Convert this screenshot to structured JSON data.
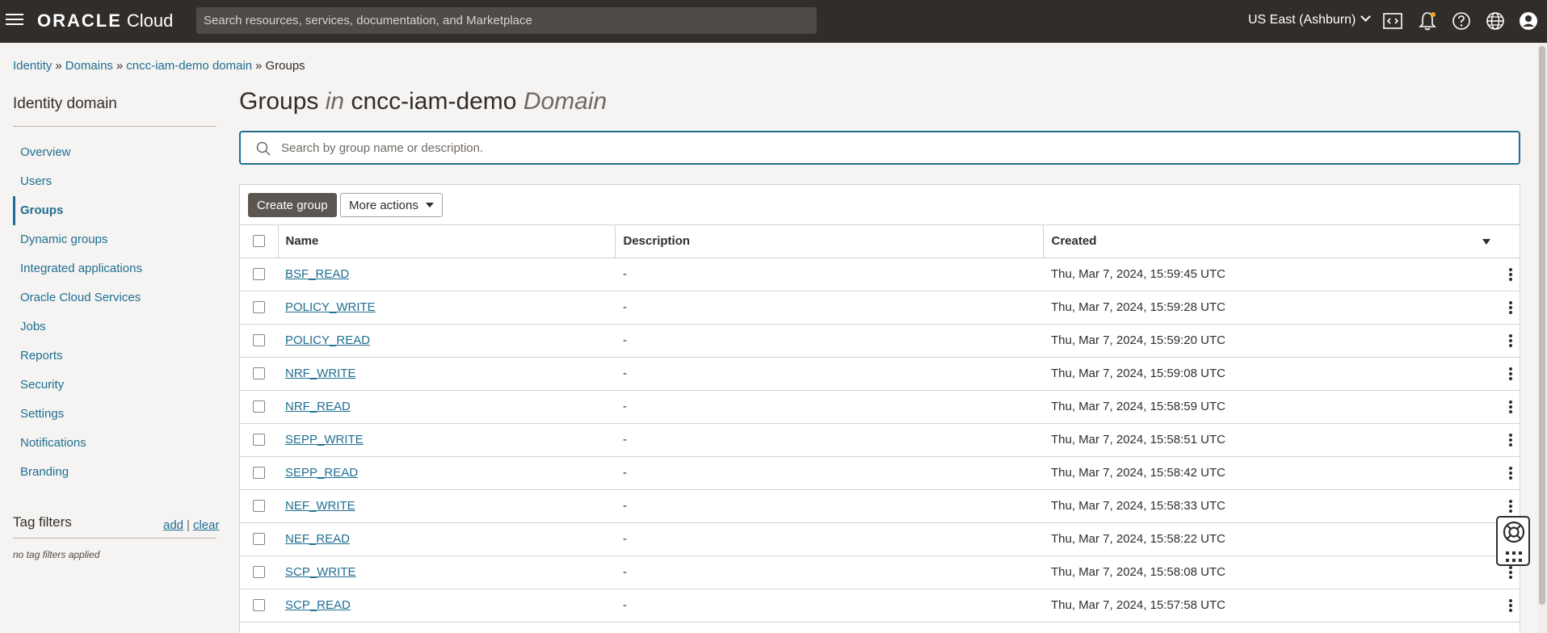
{
  "topbar": {
    "logo_brand": "ORACLE",
    "logo_product": "Cloud",
    "search_placeholder": "Search resources, services, documentation, and Marketplace",
    "region": "US East (Ashburn)",
    "icons": [
      "code-editor-icon",
      "notifications-icon",
      "help-icon",
      "language-icon",
      "profile-icon"
    ]
  },
  "breadcrumb": {
    "items": [
      "Identity",
      "Domains",
      "cncc-iam-demo domain"
    ],
    "separator": "»",
    "current": "Groups"
  },
  "sidebar": {
    "title": "Identity domain",
    "items": [
      {
        "label": "Overview"
      },
      {
        "label": "Users"
      },
      {
        "label": "Groups"
      },
      {
        "label": "Dynamic groups"
      },
      {
        "label": "Integrated applications"
      },
      {
        "label": "Oracle Cloud Services"
      },
      {
        "label": "Jobs"
      },
      {
        "label": "Reports"
      },
      {
        "label": "Security"
      },
      {
        "label": "Settings"
      },
      {
        "label": "Notifications"
      },
      {
        "label": "Branding"
      }
    ],
    "active": "Groups",
    "tag_filters": {
      "title": "Tag filters",
      "add_label": "add",
      "divider": "|",
      "clear_label": "clear",
      "empty_text": "no tag filters applied"
    }
  },
  "main": {
    "title_prefix": "Groups",
    "title_in": "in",
    "title_domain": "cncc-iam-demo",
    "title_suffix": "Domain",
    "search_placeholder": "Search by group name or description.",
    "toolbar": {
      "create_label": "Create group",
      "more_label": "More actions"
    },
    "table": {
      "columns": [
        "Name",
        "Description",
        "Created"
      ],
      "rows": [
        {
          "name": "BSF_READ",
          "description": "-",
          "created": "Thu, Mar 7, 2024, 15:59:45 UTC"
        },
        {
          "name": "POLICY_WRITE",
          "description": "-",
          "created": "Thu, Mar 7, 2024, 15:59:28 UTC"
        },
        {
          "name": "POLICY_READ",
          "description": "-",
          "created": "Thu, Mar 7, 2024, 15:59:20 UTC"
        },
        {
          "name": "NRF_WRITE",
          "description": "-",
          "created": "Thu, Mar 7, 2024, 15:59:08 UTC"
        },
        {
          "name": "NRF_READ",
          "description": "-",
          "created": "Thu, Mar 7, 2024, 15:58:59 UTC"
        },
        {
          "name": "SEPP_WRITE",
          "description": "-",
          "created": "Thu, Mar 7, 2024, 15:58:51 UTC"
        },
        {
          "name": "SEPP_READ",
          "description": "-",
          "created": "Thu, Mar 7, 2024, 15:58:42 UTC"
        },
        {
          "name": "NEF_WRITE",
          "description": "-",
          "created": "Thu, Mar 7, 2024, 15:58:33 UTC"
        },
        {
          "name": "NEF_READ",
          "description": "-",
          "created": "Thu, Mar 7, 2024, 15:58:22 UTC"
        },
        {
          "name": "SCP_WRITE",
          "description": "-",
          "created": "Thu, Mar 7, 2024, 15:58:08 UTC"
        },
        {
          "name": "SCP_READ",
          "description": "-",
          "created": "Thu, Mar 7, 2024, 15:57:58 UTC"
        }
      ]
    }
  },
  "colors": {
    "topbar_bg": "#312d2a",
    "link": "#1f6e91",
    "primary_button": "#5b5652"
  }
}
